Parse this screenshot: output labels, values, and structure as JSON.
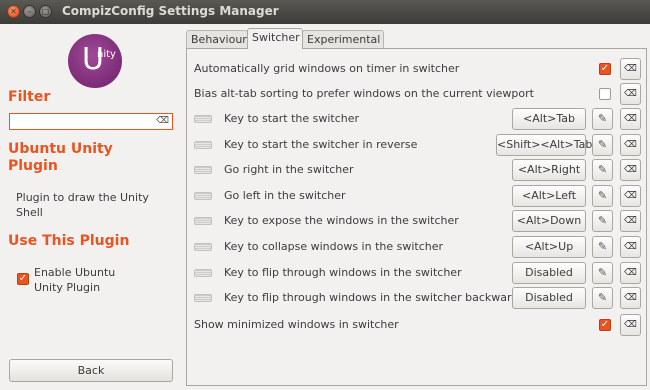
{
  "window": {
    "title": "CompizConfig Settings Manager"
  },
  "sidebar": {
    "filter_heading": "Filter",
    "filter_value": "",
    "plugin_name_line1": "Ubuntu Unity",
    "plugin_name_line2": "Plugin",
    "logo_u": "U",
    "logo_text": "nity",
    "description_line1": "Plugin to draw the Unity",
    "description_line2": "Shell",
    "use_heading": "Use This Plugin",
    "enable_label_line1": "Enable Ubuntu",
    "enable_label_line2": "Unity Plugin",
    "enable_checked": true,
    "back_label": "Back"
  },
  "tabs": [
    {
      "label": "Behaviour",
      "active": false
    },
    {
      "label": "Switcher",
      "active": true
    },
    {
      "label": "Experimental",
      "active": false
    }
  ],
  "settings": [
    {
      "label": "Automatically grid windows on timer in switcher",
      "type": "checkbox",
      "checked": true
    },
    {
      "label": "Bias alt-tab sorting to prefer windows on the current viewport",
      "type": "checkbox",
      "checked": false
    },
    {
      "label": "Key to start the switcher",
      "type": "key",
      "value": "<Alt>Tab"
    },
    {
      "label": "Key to start the switcher in reverse",
      "type": "key",
      "value": "<Shift><Alt>Tab"
    },
    {
      "label": "Go right in the switcher",
      "type": "key",
      "value": "<Alt>Right"
    },
    {
      "label": "Go left in the switcher",
      "type": "key",
      "value": "<Alt>Left"
    },
    {
      "label": "Key to expose the windows in the switcher",
      "type": "key",
      "value": "<Alt>Down"
    },
    {
      "label": "Key to collapse windows in the switcher",
      "type": "key",
      "value": "<Alt>Up"
    },
    {
      "label": "Key to flip through windows in the switcher",
      "type": "key",
      "value": "Disabled"
    },
    {
      "label": "Key to flip through windows in the switcher backwards",
      "type": "key",
      "value": "Disabled"
    },
    {
      "label": "Show minimized windows in switcher",
      "type": "checkbox",
      "checked": true
    }
  ],
  "icons": {
    "edit": "pencil-icon",
    "reset": "clear-icon"
  },
  "colors": {
    "accent": "#e95420",
    "titlebar": "#3c3b37",
    "logo": "#772a70"
  }
}
